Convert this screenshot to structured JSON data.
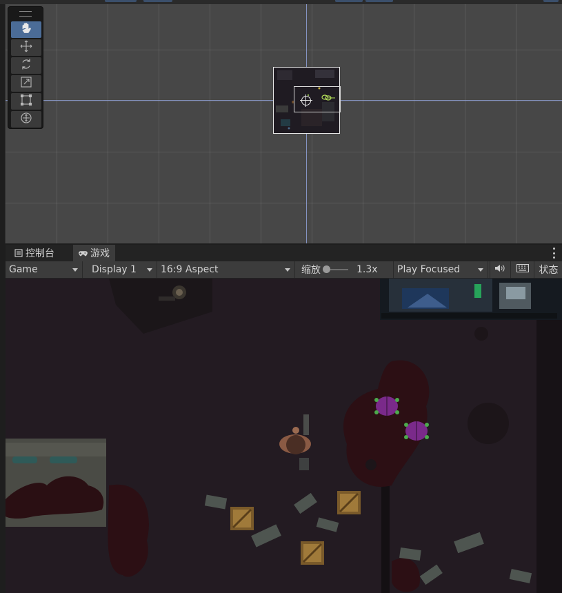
{
  "scene_toolbar": {
    "tools": [
      {
        "icon": "hand-tool-icon",
        "active": true
      },
      {
        "icon": "move-tool-icon",
        "active": false
      },
      {
        "icon": "rotate-tool-icon",
        "active": false
      },
      {
        "icon": "scale-tool-icon",
        "active": false
      },
      {
        "icon": "rect-tool-icon",
        "active": false
      },
      {
        "icon": "transform-tool-icon",
        "active": false
      }
    ]
  },
  "tabs": [
    {
      "label": "控制台",
      "icon": "console-icon",
      "active": false
    },
    {
      "label": "游戏",
      "icon": "gamepad-icon",
      "active": true
    }
  ],
  "game_toolbar": {
    "view_mode": "Game",
    "display": "Display 1",
    "aspect": "16:9 Aspect",
    "scale_label": "缩放",
    "scale_value": "1.3x",
    "play_mode": "Play Focused",
    "stats_label": "状态"
  },
  "colors": {
    "accent": "#4b6c97",
    "axis": "#8fa1d8",
    "beetle": "#8a2d9a"
  }
}
